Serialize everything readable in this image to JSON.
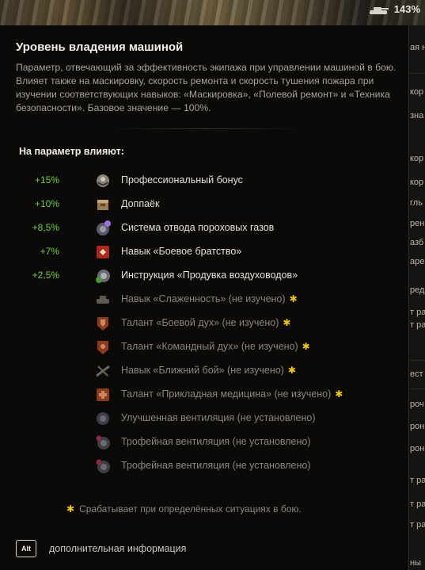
{
  "status": {
    "zoom": "143%"
  },
  "tooltip": {
    "title": "Уровень владения машиной",
    "description": "Параметр, отвечающий за эффективность экипажа при управлении машиной в бою. Влияет также на маскировку, скорость ремонта и скорость тушения пожара при изучении соответствующих навыков: «Маскировка», «Полевой ремонт» и «Техника безопасности». Базовое значение — 100%.",
    "affects_title": "На параметр влияют:",
    "active_modifiers": [
      {
        "value": "+15%",
        "label": "Профессиональный бонус",
        "icon": "professional-bonus-icon"
      },
      {
        "value": "+10%",
        "label": "Доппаёк",
        "icon": "extra-ration-icon"
      },
      {
        "value": "+8,5%",
        "label": "Система отвода пороховых газов",
        "icon": "gas-extraction-icon"
      },
      {
        "value": "+7%",
        "label": "Навык «Боевое братство»",
        "icon": "brothers-in-arms-icon"
      },
      {
        "value": "+2,5%",
        "label": "Инструкция «Продувка воздуховодов»",
        "icon": "instruction-icon"
      }
    ],
    "inactive_modifiers": [
      {
        "label": "Навык «Слаженность» (не изучено)",
        "icon": "cohesion-icon",
        "situational": true
      },
      {
        "label": "Талант «Боевой дух» (не изучено)",
        "icon": "combat-spirit-icon",
        "situational": true
      },
      {
        "label": "Талант «Командный дух» (не изучено)",
        "icon": "team-spirit-icon",
        "situational": true
      },
      {
        "label": "Навык «Ближний бой» (не изучено)",
        "icon": "close-combat-icon",
        "situational": true
      },
      {
        "label": "Талант «Прикладная медицина» (не изучено)",
        "icon": "applied-medicine-icon",
        "situational": true
      },
      {
        "label": "Улучшенная вентиляция (не установлено)",
        "icon": "ventilation-icon",
        "situational": false
      },
      {
        "label": "Трофейная вентиляция (не установлено)",
        "icon": "trophy-ventilation-icon",
        "situational": false
      },
      {
        "label": "Трофейная вентиляция (не установлено)",
        "icon": "trophy-ventilation-icon",
        "situational": false
      }
    ],
    "star_symbol": "✱",
    "footnote": "Срабатывает при определённых ситуациях в бою.",
    "alt_key": "Alt",
    "alt_label": "дополнительная информация"
  },
  "background_fragments": [
    "ая на",
    "кор",
    "зна",
    "кор",
    "кор",
    "гль",
    "рен",
    "азб",
    "аре",
    "ред",
    "т ра",
    "т ра",
    "ест",
    "роч",
    "рон",
    "рон",
    "т ра",
    "т ра",
    "т ра",
    "ны"
  ],
  "colors": {
    "positive": "#6fcf3e",
    "star": "#f0c41b",
    "text": "#e4e0d4",
    "muted": "#8a867c"
  }
}
